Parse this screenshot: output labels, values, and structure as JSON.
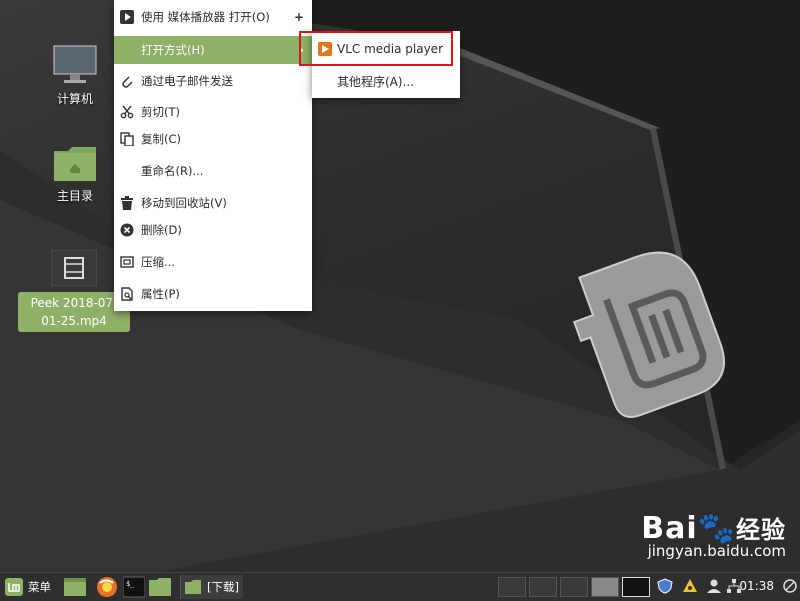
{
  "desktop": {
    "icons": [
      {
        "label": "计算机"
      },
      {
        "label": "主目录"
      },
      {
        "label": "Peek 2018-07-01-25.mp4",
        "label_line1": "Peek 2018-07-",
        "label_line2": "01-25.mp4"
      }
    ]
  },
  "context_menu": {
    "items": [
      {
        "label": "使用 媒体播放器 打开(O)",
        "trailing": "+"
      },
      {
        "label": "打开方式(H)",
        "trailing": "›"
      },
      {
        "label": "通过电子邮件发送"
      },
      {
        "label": "剪切(T)"
      },
      {
        "label": "复制(C)"
      },
      {
        "label": "重命名(R)..."
      },
      {
        "label": "移动到回收站(V)"
      },
      {
        "label": "删除(D)"
      },
      {
        "label": "压缩..."
      },
      {
        "label": "属性(P)"
      }
    ]
  },
  "submenu": {
    "items": [
      {
        "label": "VLC media player"
      },
      {
        "label": "其他程序(A)..."
      }
    ]
  },
  "panel": {
    "menu_label": "菜单",
    "window_button_label": "[下载]",
    "clock": "01:38"
  },
  "watermark": {
    "brand": "Bai",
    "brand_sub": "经验",
    "url": "jingyan.baidu.com"
  },
  "colors": {
    "accent": "#8fb167",
    "menu_bg": "#ffffff",
    "panel_bg": "#2f2f2f",
    "highlight_box": "#e0161c",
    "vlc": "#e7731b"
  }
}
